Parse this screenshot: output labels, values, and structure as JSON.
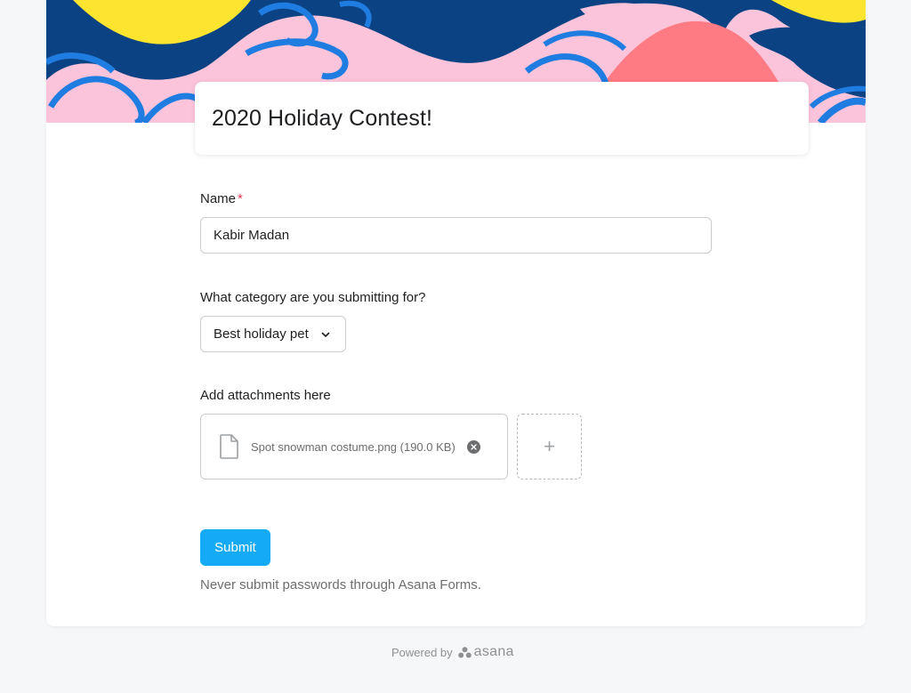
{
  "form": {
    "title": "2020 Holiday Contest!",
    "name_label": "Name",
    "required_marker": "*",
    "name_value": "Kabir Madan",
    "category_label": "What category are you submitting for?",
    "category_selected": "Best holiday pet",
    "attachments_label": "Add attachments here",
    "attachment": {
      "file_name": "Spot snowman costume.png (190.0 KB)"
    },
    "add_attachment_symbol": "+",
    "submit_label": "Submit",
    "notice": "Never submit passwords through Asana Forms."
  },
  "footer": {
    "powered_by": "Powered by",
    "brand": "asana"
  },
  "icons": {
    "chevron": "chevron-down-icon",
    "file": "file-icon",
    "remove": "close-circle-icon",
    "brand_logo": "asana-logo-icon"
  },
  "colors": {
    "submit_button": "#14aaf5",
    "required_star": "#e8384f",
    "banner_navy": "#0b4283",
    "banner_pink": "#fcc4da",
    "banner_yellow": "#fde42e",
    "banner_coral": "#ff7b84",
    "banner_blue": "#1f7ce0"
  }
}
